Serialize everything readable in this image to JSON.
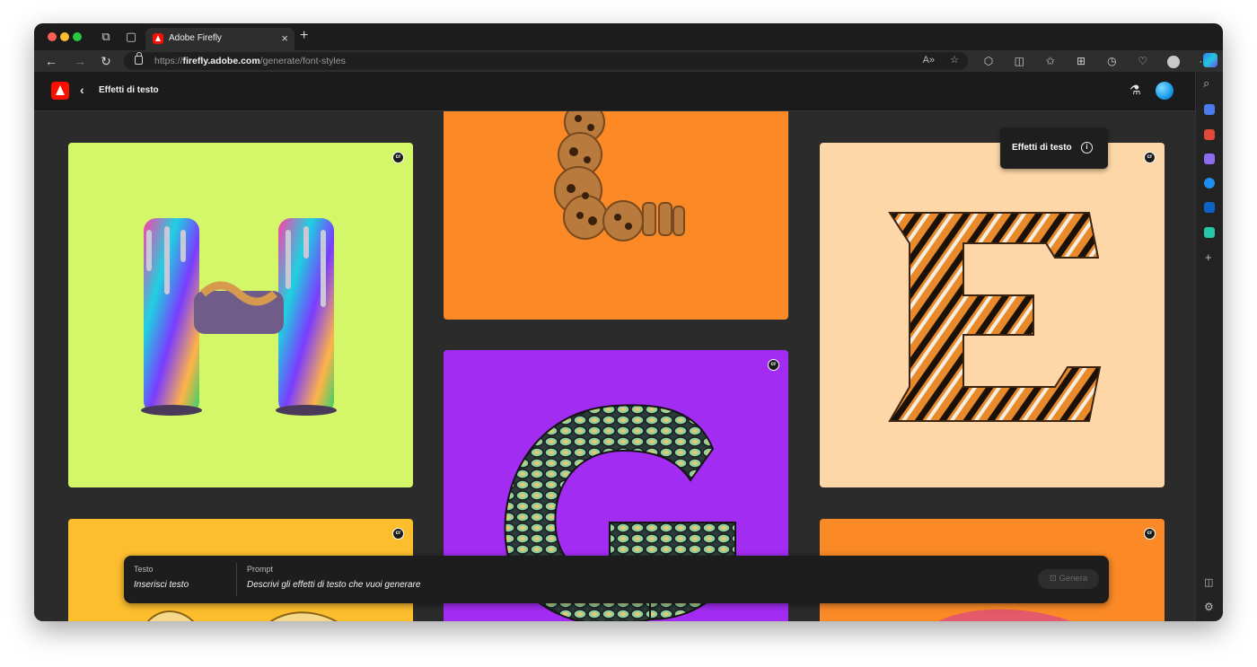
{
  "browser": {
    "tab_title": "Adobe Firefly",
    "url_scheme": "https://",
    "url_host": "firefly.adobe.com",
    "url_path": "/generate/font-styles"
  },
  "app": {
    "title": "Effetti di testo"
  },
  "tooltip": {
    "text": "Effetti di testo"
  },
  "cards": [
    {
      "letter": "H",
      "bg": "#d4f76a",
      "badge": "cr"
    },
    {
      "letter": "L",
      "bg": "#fb8a26",
      "badge": "cr"
    },
    {
      "letter": "E",
      "bg": "#fed7a8",
      "badge": "cr"
    },
    {
      "letter": "G",
      "bg": "#a32cf2",
      "badge": "cr"
    },
    {
      "bg": "#fdbe2e",
      "badge": "cr"
    },
    {
      "bg": "#fb8a26",
      "badge": "cr"
    }
  ],
  "prompt_bar": {
    "text_label": "Testo",
    "text_placeholder": "Inserisci testo",
    "prompt_label": "Prompt",
    "prompt_placeholder": "Descrivi gli effetti di testo che vuoi generare",
    "generate_label": "Genera"
  }
}
